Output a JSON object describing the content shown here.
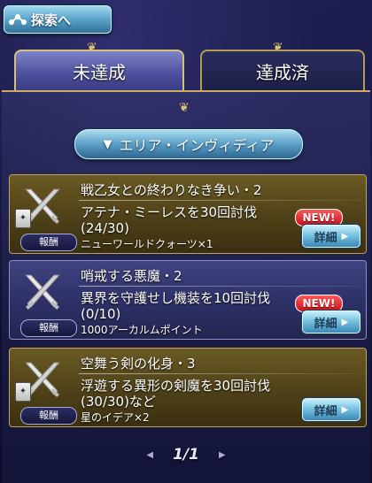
{
  "header": {
    "explore_label": "探索へ",
    "explore_icon": "network-icon"
  },
  "tabs": [
    {
      "label": "未達成",
      "active": true
    },
    {
      "label": "達成済",
      "active": false
    }
  ],
  "area_selector": {
    "label": "エリア・インヴィディア",
    "arrow": "▼"
  },
  "missions": [
    {
      "title": "戦乙女との終わりなき争い・2",
      "desc_line1": "アテナ・ミーレスを30回討伐",
      "desc_line2": "(24/30)",
      "reward_label": "報酬",
      "reward": "ニューワールドクォーツ×1",
      "new": "NEW!",
      "detail_label": "詳細"
    },
    {
      "title": "哨戒する悪魔・2",
      "desc_line1": "異界を守護せし機装を10回討伐",
      "desc_line2": "(0/10)",
      "reward_label": "報酬",
      "reward": "1000アーカルムポイント",
      "new": "NEW!",
      "detail_label": "詳細"
    },
    {
      "title": "空舞う剣の化身・3",
      "desc_line1": "浮遊する異形の剣魔を30回討伐",
      "desc_line2": "(30/30)など",
      "reward_label": "報酬",
      "reward": "星のイデア×2",
      "detail_label": "詳細"
    }
  ],
  "pager": {
    "text": "1/1"
  },
  "colors": {
    "accent_gold": "#c9ac62",
    "button_blue": "#5c9fc6",
    "new_red": "#c8101c"
  }
}
